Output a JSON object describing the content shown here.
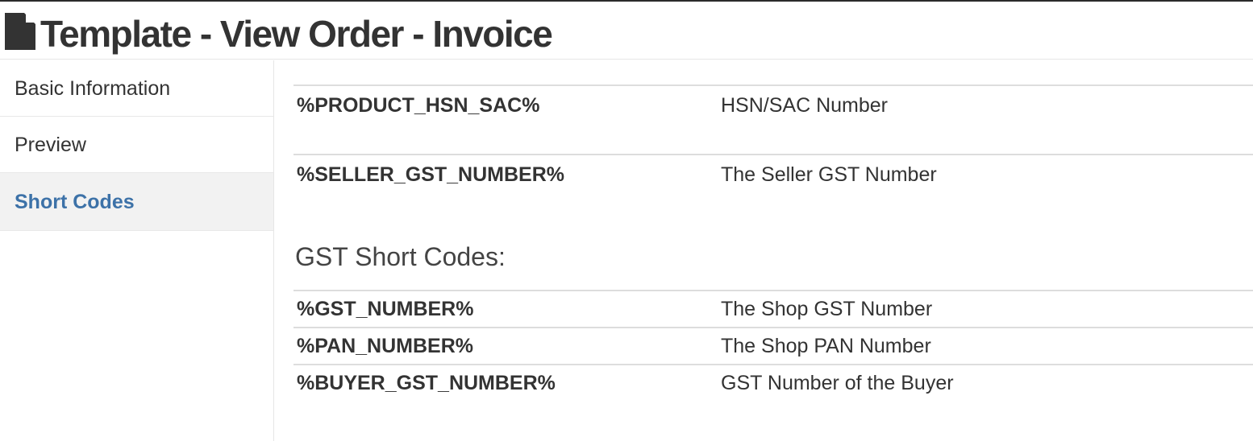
{
  "header": {
    "title": "Template - View Order - Invoice",
    "icon": "document-icon"
  },
  "sidebar": {
    "items": [
      {
        "label": "Basic Information",
        "active": false
      },
      {
        "label": "Preview",
        "active": false
      },
      {
        "label": "Short Codes",
        "active": true
      }
    ]
  },
  "main": {
    "product_codes": [
      {
        "code": "%PRODUCT_HSN_SAC%",
        "description": "HSN/SAC Number"
      },
      {
        "code": "%SELLER_GST_NUMBER%",
        "description": "The Seller GST Number"
      }
    ],
    "gst_heading": "GST Short Codes:",
    "gst_codes": [
      {
        "code": "%GST_NUMBER%",
        "description": "The Shop GST Number"
      },
      {
        "code": "%PAN_NUMBER%",
        "description": "The Shop PAN Number"
      },
      {
        "code": "%BUYER_GST_NUMBER%",
        "description": "GST Number of the Buyer"
      }
    ]
  },
  "colors": {
    "active_link": "#3d72a8",
    "active_bg": "#f2f2f2",
    "text": "#333333",
    "divider": "#dddddd"
  }
}
